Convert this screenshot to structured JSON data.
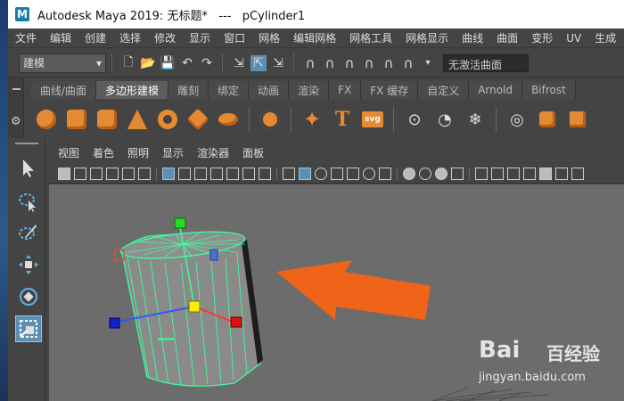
{
  "window": {
    "logo_letter": "M",
    "title": "Autodesk Maya 2019: 无标题*   ---   pCylinder1"
  },
  "menubar": [
    "文件",
    "编辑",
    "创建",
    "选择",
    "修改",
    "显示",
    "窗口",
    "网格",
    "编辑网格",
    "网格工具",
    "网格显示",
    "曲线",
    "曲面",
    "变形",
    "UV",
    "生成"
  ],
  "statusline": {
    "mode": "建模",
    "no_live_surface": "无激活曲面"
  },
  "shelf": {
    "tabs": [
      "曲线/曲面",
      "多边形建模",
      "雕刻",
      "绑定",
      "动画",
      "渲染",
      "FX",
      "FX 缓存",
      "自定义",
      "Arnold",
      "Bifrost"
    ],
    "active_tab": "多边形建模",
    "text_tool": "T",
    "svg_tool": "svg"
  },
  "panel": {
    "menus": [
      "视图",
      "着色",
      "照明",
      "显示",
      "渲染器",
      "面板"
    ]
  },
  "scene": {
    "selected_object": "pCylinder1",
    "wire_color": "#3aff9a",
    "arrow_color": "#f0641a"
  },
  "watermark": {
    "logo": "Bai",
    "logo_suffix": "百经验",
    "url": "jingyan.baidu.com"
  }
}
